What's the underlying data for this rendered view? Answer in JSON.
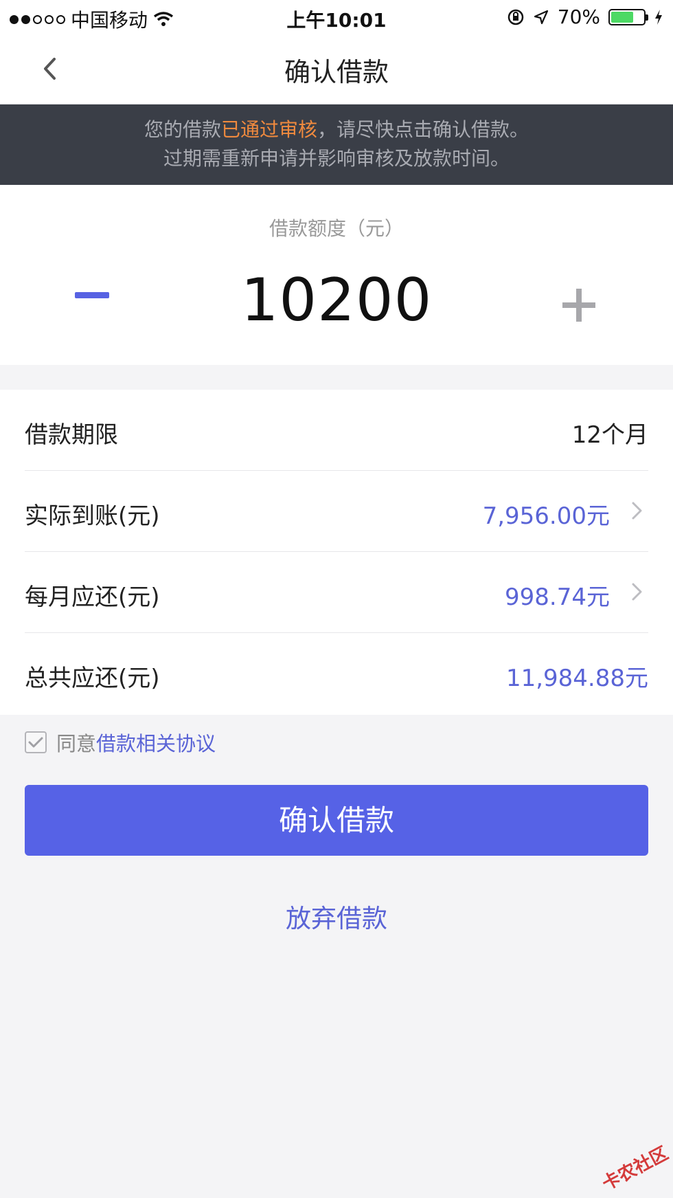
{
  "status_bar": {
    "carrier": "中国移动",
    "time": "上午10:01",
    "battery_percent": "70%",
    "battery_level": 0.7,
    "icons": [
      "wifi-icon",
      "orientation-lock-icon",
      "location-arrow-icon",
      "charging-bolt-icon"
    ]
  },
  "nav": {
    "title": "确认借款"
  },
  "notice": {
    "line1_prefix": "您的借款",
    "line1_highlight": "已通过审核",
    "line1_suffix": "，请尽快点击确认借款。",
    "line2": "过期需重新申请并影响审核及放款时间。",
    "highlight_color": "#f08a3e"
  },
  "amount": {
    "label": "借款额度（元）",
    "value": "10200"
  },
  "details": [
    {
      "label": "借款期限",
      "value": "12个月"
    },
    {
      "label": "实际到账(元)",
      "value": "7,956.00元"
    },
    {
      "label": "每月应还(元)",
      "value": "998.74元"
    },
    {
      "label": "总共应还(元)",
      "value": "11,984.88元"
    }
  ],
  "agreement": {
    "prefix": "同意",
    "link": "借款相关协议",
    "checked": true
  },
  "actions": {
    "confirm_label": "确认借款",
    "abandon_label": "放弃借款"
  },
  "watermark": {
    "text": "卡农社区"
  },
  "colors": {
    "accent": "#5662e6",
    "notice_bg": "#3a3e47",
    "page_bg": "#f4f4f6"
  }
}
